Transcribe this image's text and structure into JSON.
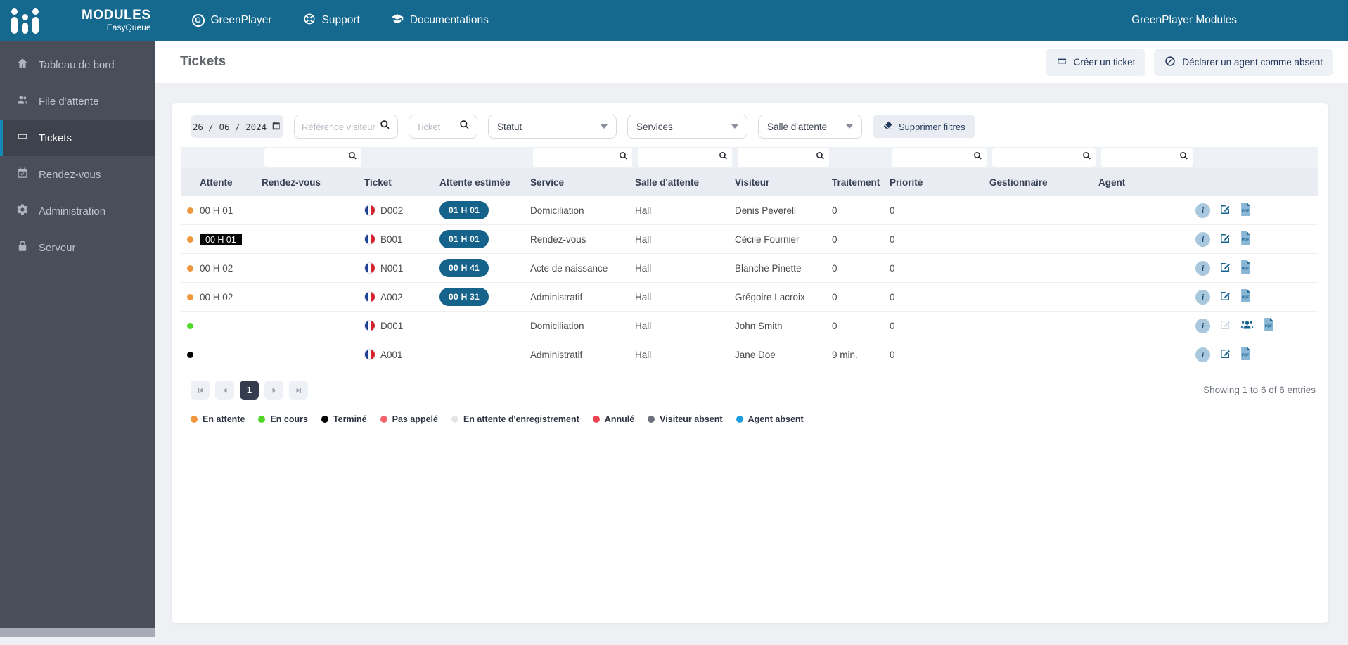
{
  "topbar": {
    "brand_title": "MODULES",
    "brand_subtitle": "EasyQueue",
    "nav": [
      {
        "label": "GreenPlayer",
        "icon": "greenplayer-icon"
      },
      {
        "label": "Support",
        "icon": "lifering-icon"
      },
      {
        "label": "Documentations",
        "icon": "graduation-cap-icon"
      }
    ],
    "right_text": "GreenPlayer Modules"
  },
  "sidebar": {
    "items": [
      {
        "label": "Tableau de bord",
        "icon": "home-icon",
        "active": false
      },
      {
        "label": "File d'attente",
        "icon": "users-icon",
        "active": false
      },
      {
        "label": "Tickets",
        "icon": "ticket-icon",
        "active": true
      },
      {
        "label": "Rendez-vous",
        "icon": "calendar-check-icon",
        "active": false
      },
      {
        "label": "Administration",
        "icon": "gear-icon",
        "active": false
      },
      {
        "label": "Serveur",
        "icon": "lock-icon",
        "active": false
      }
    ]
  },
  "page": {
    "title": "Tickets",
    "create_ticket_label": "Créer un ticket",
    "declare_absent_label": "Déclarer un agent comme absent"
  },
  "filters": {
    "date_value": "26 / 06 / 2024",
    "reference_placeholder": "Référence visiteur",
    "ticket_placeholder": "Ticket",
    "statut_label": "Statut",
    "services_label": "Services",
    "salle_label": "Salle d'attente",
    "clear_label": "Supprimer filtres"
  },
  "table": {
    "columns": [
      "Attente",
      "Rendez-vous",
      "Ticket",
      "Attente estimée",
      "Service",
      "Salle d'attente",
      "Visiteur",
      "Traitement",
      "Priorité",
      "Gestionnaire",
      "Agent"
    ],
    "rows": [
      {
        "status": "en-attente",
        "status_color": "#f0963c",
        "attente": "00 H 01",
        "attente_highlight": false,
        "rdv": "",
        "ticket": "D002",
        "estimee": "01 H 01",
        "service": "Domiciliation",
        "salle": "Hall",
        "visiteur": "Denis Peverell",
        "traitement": "0",
        "priorite": "0",
        "gestionnaire": "",
        "agent": "",
        "actions": [
          "info",
          "edit",
          "pdf"
        ]
      },
      {
        "status": "en-attente",
        "status_color": "#f0963c",
        "attente": "00 H 01",
        "attente_highlight": true,
        "rdv": "",
        "ticket": "B001",
        "estimee": "01 H 01",
        "service": "Rendez-vous",
        "salle": "Hall",
        "visiteur": "Cécile Fournier",
        "traitement": "0",
        "priorite": "0",
        "gestionnaire": "",
        "agent": "",
        "actions": [
          "info",
          "edit",
          "pdf"
        ]
      },
      {
        "status": "en-attente",
        "status_color": "#f0963c",
        "attente": "00 H 02",
        "attente_highlight": false,
        "rdv": "",
        "ticket": "N001",
        "estimee": "00 H 41",
        "service": "Acte de naissance",
        "salle": "Hall",
        "visiteur": "Blanche Pinette",
        "traitement": "0",
        "priorite": "0",
        "gestionnaire": "",
        "agent": "",
        "actions": [
          "info",
          "edit",
          "pdf"
        ]
      },
      {
        "status": "en-attente",
        "status_color": "#f0963c",
        "attente": "00 H 02",
        "attente_highlight": false,
        "rdv": "",
        "ticket": "A002",
        "estimee": "00 H 31",
        "service": "Administratif",
        "salle": "Hall",
        "visiteur": "Grégoire Lacroix",
        "traitement": "0",
        "priorite": "0",
        "gestionnaire": "",
        "agent": "",
        "actions": [
          "info",
          "edit",
          "pdf"
        ]
      },
      {
        "status": "en-cours",
        "status_color": "#52d726",
        "attente": "",
        "attente_highlight": false,
        "rdv": "",
        "ticket": "D001",
        "estimee": "",
        "service": "Domiciliation",
        "salle": "Hall",
        "visiteur": "John Smith",
        "traitement": "0",
        "priorite": "0",
        "gestionnaire": "",
        "agent": "",
        "actions": [
          "info",
          "edit-disabled",
          "assign-agent",
          "pdf"
        ]
      },
      {
        "status": "termine",
        "status_color": "#000000",
        "attente": "",
        "attente_highlight": false,
        "rdv": "",
        "ticket": "A001",
        "estimee": "",
        "service": "Administratif",
        "salle": "Hall",
        "visiteur": "Jane Doe",
        "traitement": "9 min.",
        "priorite": "0",
        "gestionnaire": "",
        "agent": "",
        "actions": [
          "info",
          "edit",
          "pdf"
        ]
      }
    ]
  },
  "pagination": {
    "current_page": "1",
    "summary": "Showing 1 to 6 of 6 entries"
  },
  "legend": [
    {
      "label": "En attente",
      "color": "#f0963c"
    },
    {
      "label": "En cours",
      "color": "#52d726"
    },
    {
      "label": "Terminé",
      "color": "#000000"
    },
    {
      "label": "Pas appelé",
      "color": "#f4626d"
    },
    {
      "label": "En attente d'enregistrement",
      "color": "#e6e6e6"
    },
    {
      "label": "Annulé",
      "color": "#ee4451"
    },
    {
      "label": "Visiteur absent",
      "color": "#6d717c"
    },
    {
      "label": "Agent absent",
      "color": "#1f9ede"
    }
  ],
  "colors": {
    "topbar": "#15688e",
    "sidebar": "#4a4e5a",
    "sidebar_active_accent": "#1588b8",
    "badge_blue": "#15628b",
    "header_row_bg": "#e9ecf2"
  }
}
